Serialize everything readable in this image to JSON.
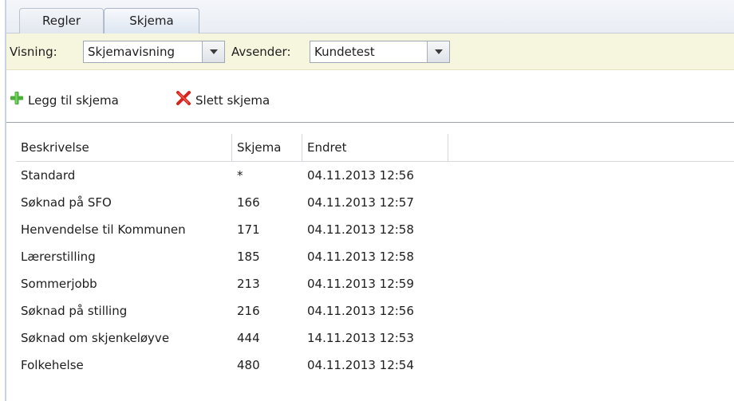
{
  "tabs": [
    {
      "label": "Regler",
      "active": false
    },
    {
      "label": "Skjema",
      "active": true
    }
  ],
  "filter": {
    "view_label": "Visning:",
    "view_value": "Skjemavisning",
    "sender_label": "Avsender:",
    "sender_value": "Kundetest"
  },
  "toolbar": {
    "add_label": "Legg til skjema",
    "delete_label": "Slett skjema"
  },
  "grid": {
    "columns": [
      "Beskrivelse",
      "Skjema",
      "Endret"
    ],
    "rows": [
      {
        "description": "Standard",
        "schema": "*",
        "changed": "04.11.2013 12:56"
      },
      {
        "description": "Søknad på SFO",
        "schema": "166",
        "changed": "04.11.2013 12:57"
      },
      {
        "description": "Henvendelse til Kommunen",
        "schema": "171",
        "changed": "04.11.2013 12:58"
      },
      {
        "description": "Lærerstilling",
        "schema": "185",
        "changed": "04.11.2013 12:58"
      },
      {
        "description": "Sommerjobb",
        "schema": "213",
        "changed": "04.11.2013 12:59"
      },
      {
        "description": "Søknad på stilling",
        "schema": "216",
        "changed": "04.11.2013 12:56"
      },
      {
        "description": "Søknad om skjenkeløyve",
        "schema": "444",
        "changed": "14.11.2013 12:53"
      },
      {
        "description": "Folkehelse",
        "schema": "480",
        "changed": "04.11.2013 12:54"
      }
    ]
  },
  "icons": {
    "add": "plus-icon",
    "delete": "close-icon",
    "dropdown": "chevron-down-icon"
  },
  "colors": {
    "filter_bar_bg": "#f6f5de",
    "add_icon": "#4caf3a",
    "delete_icon": "#d8221c"
  }
}
